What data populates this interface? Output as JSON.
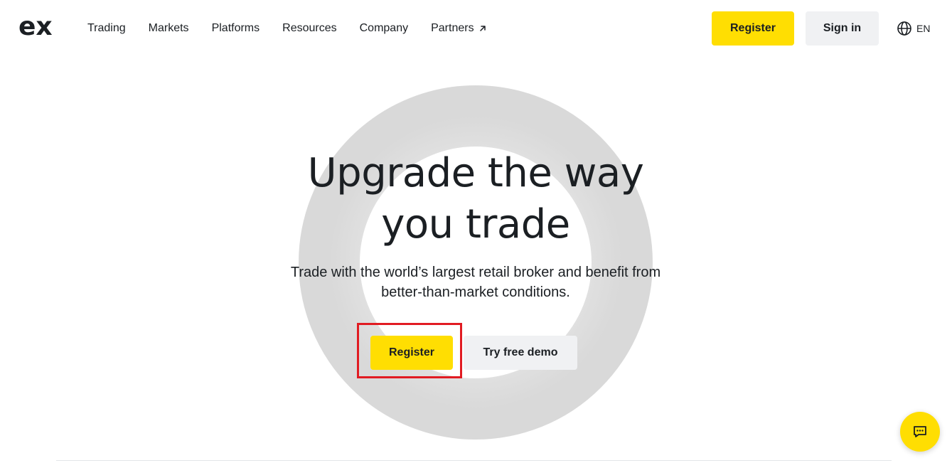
{
  "header": {
    "logo_text": "ex",
    "nav": [
      {
        "label": "Trading"
      },
      {
        "label": "Markets"
      },
      {
        "label": "Platforms"
      },
      {
        "label": "Resources"
      },
      {
        "label": "Company"
      },
      {
        "label": "Partners"
      }
    ],
    "register_label": "Register",
    "signin_label": "Sign in",
    "language": "EN"
  },
  "hero": {
    "title_line1": "Upgrade the way",
    "title_line2": "you trade",
    "subtitle_line1": "Trade with the world’s largest retail broker and benefit from",
    "subtitle_line2": "better-than-market conditions.",
    "register_label": "Register",
    "demo_label": "Try free demo"
  },
  "colors": {
    "accent": "#ffde02",
    "secondary_button": "#f0f1f3",
    "highlight_border": "#e11b22",
    "text": "#1b1f23"
  },
  "icons": {
    "logo": "exness-logo",
    "partners_arrow": "external-arrow-icon",
    "language": "globe-icon",
    "chat": "chat-icon"
  }
}
